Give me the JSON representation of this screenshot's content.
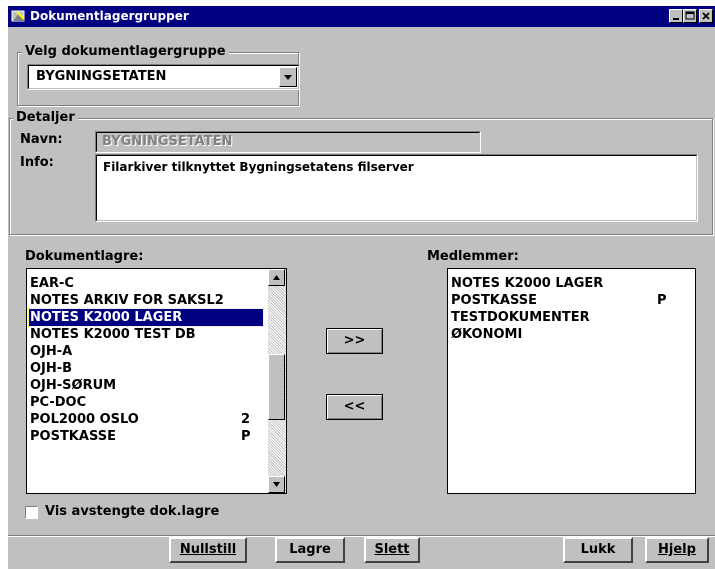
{
  "window": {
    "title": "Dokumentlagergrupper"
  },
  "group_select": {
    "legend": "Velg dokumentlagergruppe",
    "selected": "BYGNINGSETATEN"
  },
  "details": {
    "legend": "Detaljer",
    "name_label": "Navn:",
    "name_value": "BYGNINGSETATEN",
    "info_label": "Info:",
    "info_value": "Filarkiver tilknyttet Bygningsetatens filserver"
  },
  "stores": {
    "label": "Dokumentlagre:",
    "items": [
      {
        "name": "EAR-C",
        "flag": ""
      },
      {
        "name": "NOTES ARKIV FOR SAKSL2",
        "flag": ""
      },
      {
        "name": "NOTES K2000 LAGER",
        "flag": "",
        "selected": true
      },
      {
        "name": "NOTES K2000 TEST DB",
        "flag": ""
      },
      {
        "name": "OJH-A",
        "flag": ""
      },
      {
        "name": "OJH-B",
        "flag": ""
      },
      {
        "name": "OJH-SØRUM",
        "flag": ""
      },
      {
        "name": "PC-DOC",
        "flag": ""
      },
      {
        "name": "POL2000 OSLO",
        "flag": "2"
      },
      {
        "name": "POSTKASSE",
        "flag": "P"
      }
    ]
  },
  "members": {
    "label": "Medlemmer:",
    "items": [
      {
        "name": "NOTES K2000 LAGER",
        "flag": ""
      },
      {
        "name": "POSTKASSE",
        "flag": "P"
      },
      {
        "name": "TESTDOKUMENTER",
        "flag": ""
      },
      {
        "name": "ØKONOMI",
        "flag": ""
      }
    ]
  },
  "transfer": {
    "add_label": ">>",
    "remove_label": "<<"
  },
  "show_closed": {
    "label": "Vis avstengte dok.lagre",
    "checked": false
  },
  "buttons": {
    "reset": "Nullstill",
    "save": "Lagre",
    "delete": "Slett",
    "close": "Lukk",
    "help": "Hjelp"
  }
}
